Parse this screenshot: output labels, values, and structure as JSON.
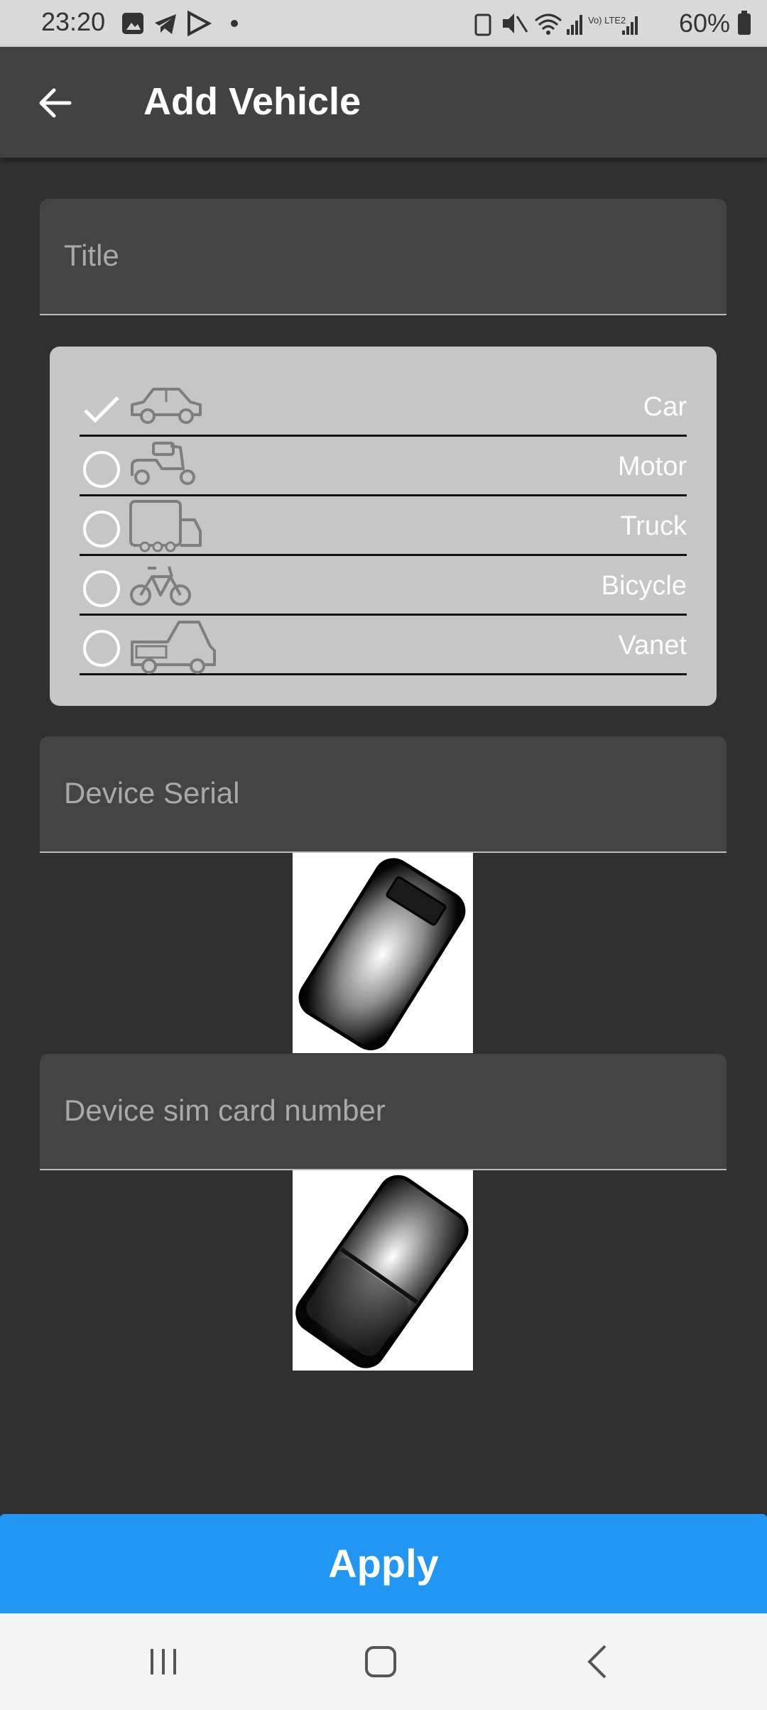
{
  "status_bar": {
    "time": "23:20",
    "battery": "60%",
    "signal_label": "Vo) LTE2"
  },
  "app_bar": {
    "title": "Add Vehicle",
    "back_icon": "arrow-left-icon"
  },
  "form": {
    "title_placeholder": "Title",
    "serial_placeholder": "Device Serial",
    "sim_placeholder": "Device sim card number"
  },
  "vehicle_types": [
    {
      "label": "Car",
      "icon": "car-icon",
      "selected": true
    },
    {
      "label": "Motor",
      "icon": "motor-scooter-icon",
      "selected": false
    },
    {
      "label": "Truck",
      "icon": "truck-icon",
      "selected": false
    },
    {
      "label": "Bicycle",
      "icon": "bicycle-icon",
      "selected": false
    },
    {
      "label": "Vanet",
      "icon": "van-icon",
      "selected": false
    }
  ],
  "apply_label": "Apply",
  "colors": {
    "background": "#303030",
    "app_bar": "#424242",
    "field": "#444444",
    "panel": "#c6c6c6",
    "accent": "#2196f3"
  }
}
